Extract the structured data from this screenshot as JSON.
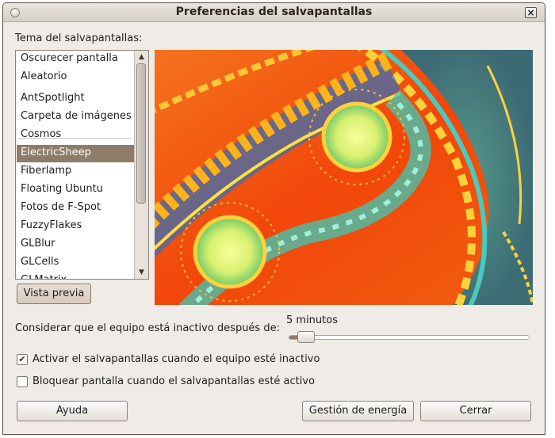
{
  "window": {
    "title": "Preferencias del salvapantallas",
    "close_glyph": "×"
  },
  "theme_list": {
    "label": "Tema del salvapantallas:",
    "top_items": [
      "Oscurecer pantalla",
      "Aleatorio"
    ],
    "items": [
      "AntSpotlight",
      "Carpeta de imágenes",
      "Cosmos",
      "ElectricSheep",
      "Fiberlamp",
      "Floating Ubuntu",
      "Fotos de F-Spot",
      "FuzzyFlakes",
      "GLBlur",
      "GLCells",
      "GLMatrix"
    ],
    "selected": "ElectricSheep"
  },
  "preview_button": {
    "label": "Vista previa"
  },
  "idle": {
    "label": "Considerar que el equipo está inactivo después de:",
    "value_text": "5 minutos",
    "slider_fraction": 0.04
  },
  "checkboxes": {
    "activate": {
      "label": "Activar el salvapantallas cuando el equipo esté inactivo",
      "checked": true
    },
    "lock": {
      "label": "Bloquear pantalla cuando el salvapantallas esté activo",
      "checked": false
    }
  },
  "buttons": {
    "help": "Ayuda",
    "power": "Gestión de energía",
    "close": "Cerrar"
  },
  "colors": {
    "accent": "#8e7b6a",
    "window_bg": "#efebe7",
    "preview_orange": "#f4500a"
  },
  "icons": {
    "window_menu": "circle-menu-icon",
    "window_close": "close-icon",
    "scroll_up": "chevron-up-icon",
    "scroll_down": "chevron-down-icon",
    "check": "checkmark-icon"
  }
}
